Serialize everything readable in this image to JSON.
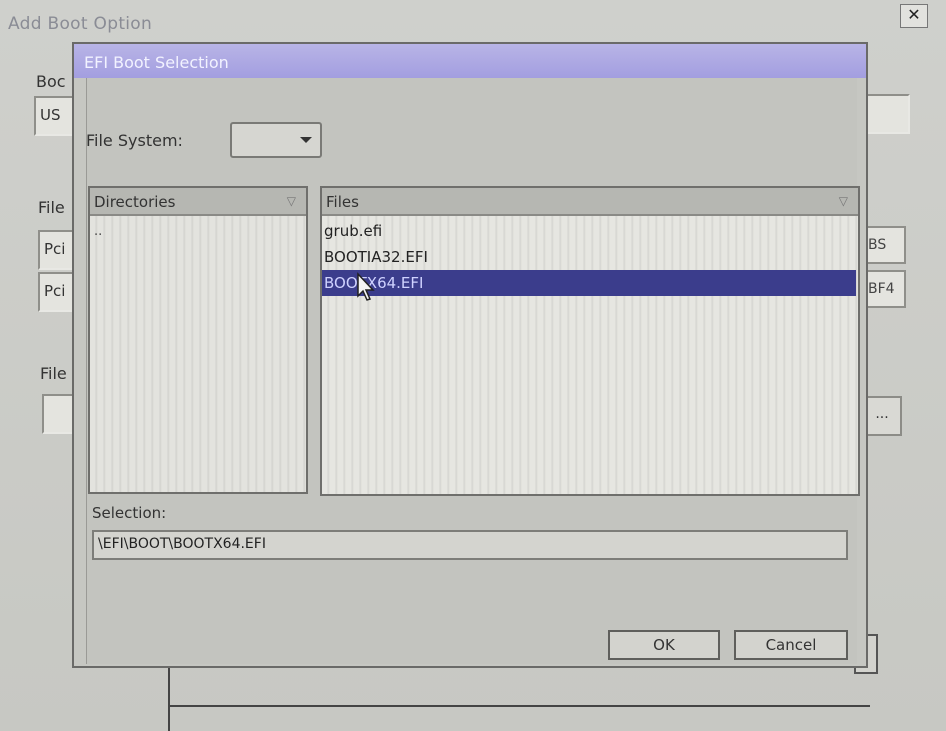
{
  "outer_window": {
    "title": "Add Boot Option",
    "close_glyph": "✕",
    "label_boot": "Boc",
    "field_boot_value": "US",
    "label_file1": "File",
    "pci_row1": "Pci",
    "pci_row1_tail": "BS",
    "pci_row2": "Pci",
    "pci_row2_tail": "BF4",
    "label_file2": "File",
    "browse_label": "..."
  },
  "dialog": {
    "title": "EFI Boot Selection",
    "file_system_label": "File System:",
    "file_system_value": "",
    "directories_header": "Directories",
    "directories_items": [
      "..",
      ""
    ],
    "files_header": "Files",
    "files": [
      {
        "name": "grub.efi",
        "selected": false
      },
      {
        "name": "BOOTIA32.EFI",
        "selected": false
      },
      {
        "name": "BOOTX64.EFI",
        "selected": true
      }
    ],
    "selection_label": "Selection:",
    "selection_value": "\\EFI\\BOOT\\BOOTX64.EFI",
    "ok_label": "OK",
    "cancel_label": "Cancel"
  },
  "colors": {
    "titlebar": "#a39ee0",
    "selected_row": "#3b3d8c"
  }
}
